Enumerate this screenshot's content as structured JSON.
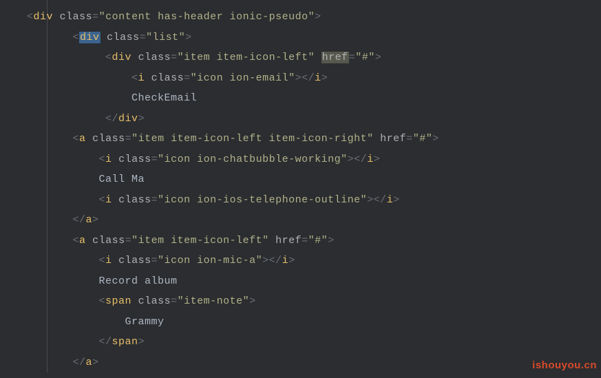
{
  "lines": {
    "l1": {
      "pre": "  ",
      "t": "div",
      "attrs": [
        {
          "n": "class",
          "v": "content has-header ionic-pseudo"
        }
      ],
      "open": true
    },
    "l2": {
      "pre": "         ",
      "t": "div",
      "attrs": [
        {
          "n": "class",
          "v": "list"
        }
      ],
      "open": true,
      "hlTag": true
    },
    "l3": {
      "pre": "              ",
      "t": "div",
      "attrs": [
        {
          "n": "class",
          "v": "item item-icon-left"
        },
        {
          "n": "href",
          "v": "#",
          "hl": true
        }
      ],
      "open": true
    },
    "l4": {
      "pre": "                  ",
      "t": "i",
      "attrs": [
        {
          "n": "class",
          "v": "icon ion-email"
        }
      ],
      "selfclose": "i"
    },
    "l5": {
      "pre": "                  ",
      "text": "CheckEmail"
    },
    "l6": {
      "pre": "              ",
      "close": "div"
    },
    "l7": {
      "pre": "         ",
      "t": "a",
      "attrs": [
        {
          "n": "class",
          "v": "item item-icon-left item-icon-right"
        },
        {
          "n": "href",
          "v": "#"
        }
      ],
      "open": true
    },
    "l8": {
      "pre": "             ",
      "t": "i",
      "attrs": [
        {
          "n": "class",
          "v": "icon ion-chatbubble-working"
        }
      ],
      "selfclose": "i"
    },
    "l9": {
      "pre": "             ",
      "text": "Call Ma"
    },
    "l10": {
      "pre": "             ",
      "t": "i",
      "attrs": [
        {
          "n": "class",
          "v": "icon ion-ios-telephone-outline"
        }
      ],
      "selfclose": "i"
    },
    "l11": {
      "pre": "         ",
      "close": "a"
    },
    "l12": {
      "pre": "         ",
      "t": "a",
      "attrs": [
        {
          "n": "class",
          "v": "item item-icon-left"
        },
        {
          "n": "href",
          "v": "#"
        }
      ],
      "open": true
    },
    "l13": {
      "pre": "             ",
      "t": "i",
      "attrs": [
        {
          "n": "class",
          "v": "icon ion-mic-a"
        }
      ],
      "selfclose": "i"
    },
    "l14": {
      "pre": "             ",
      "text": "Record album"
    },
    "l15": {
      "pre": "             ",
      "t": "span",
      "attrs": [
        {
          "n": "class",
          "v": "item-note"
        }
      ],
      "open": true
    },
    "l16": {
      "pre": "                 ",
      "text": "Grammy"
    },
    "l17": {
      "pre": "             ",
      "close": "span"
    },
    "l18": {
      "pre": "         ",
      "close": "a"
    }
  },
  "watermark": "ishouyou.cn",
  "q": "″"
}
